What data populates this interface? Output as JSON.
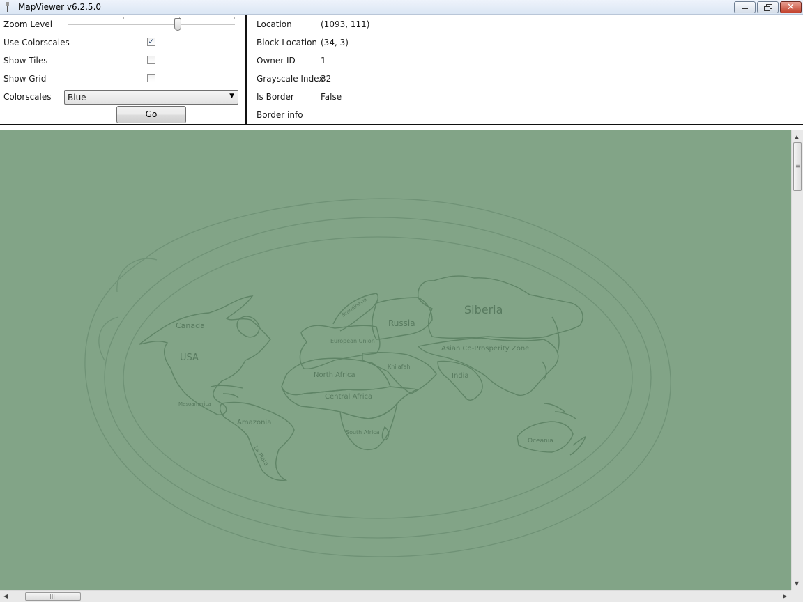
{
  "window": {
    "title": "MapViewer v6.2.5.0",
    "close_glyph": "✕"
  },
  "controls": {
    "zoom_label": "Zoom Level",
    "zoom_level": 0.66,
    "use_colorscales_label": "Use Colorscales",
    "use_colorscales_checked": true,
    "show_tiles_label": "Show Tiles",
    "show_tiles_checked": false,
    "show_grid_label": "Show Grid",
    "show_grid_checked": false,
    "colorscales_label": "Colorscales",
    "colorscales_value": "Blue",
    "go_label": "Go"
  },
  "info": {
    "location_label": "Location",
    "location_value": "(1093, 111)",
    "block_location_label": "Block Location",
    "block_location_value": "(34, 3)",
    "owner_id_label": "Owner ID",
    "owner_id_value": "1",
    "grayscale_index_label": "Grayscale Index",
    "grayscale_index_value": "32",
    "is_border_label": "Is Border",
    "is_border_value": "False",
    "border_info_label": "Border info",
    "border_info_value": ""
  },
  "map": {
    "background_color": "#82a487",
    "regions": {
      "canada": "Canada",
      "usa": "USA",
      "mesoamerica": "Mesoamerica",
      "amazonia": "Amazonia",
      "la_plata": "La Plata",
      "scandinavia": "Scandinavia",
      "european_union": "European Union",
      "russia": "Russia",
      "siberia": "Siberia",
      "asian_coprosperity": "Asian Co-Prosperity Zone",
      "khilafah": "Khilafah",
      "india": "India",
      "north_africa": "North Africa",
      "central_africa": "Central Africa",
      "south_africa": "South Africa",
      "oceania": "Oceania"
    }
  },
  "scrollbars": {
    "vertical_position": 0.0,
    "horizontal_position": 0.0
  }
}
